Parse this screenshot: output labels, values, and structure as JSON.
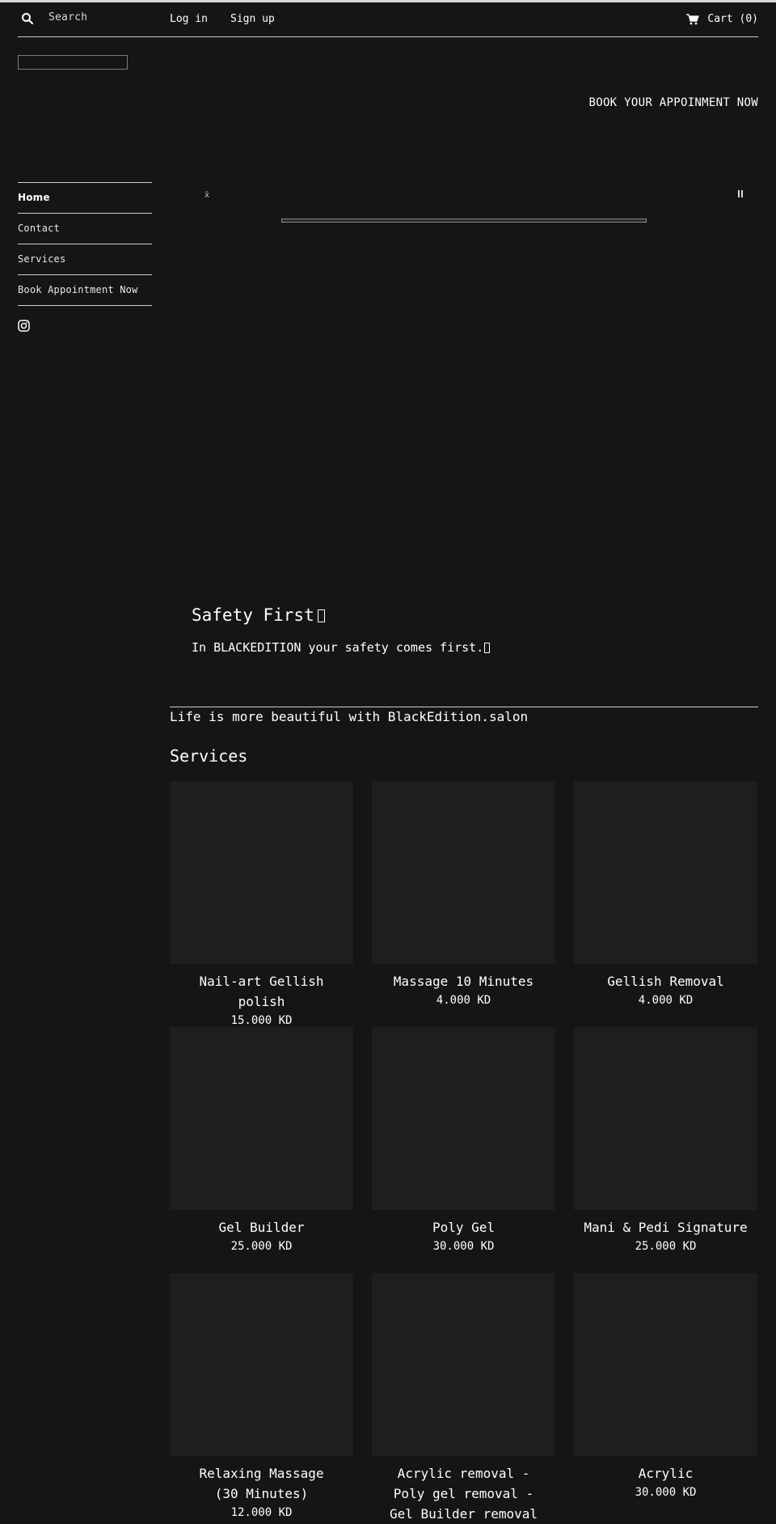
{
  "header": {
    "search_placeholder": "Search",
    "login_label": "Log in",
    "signup_label": "Sign up",
    "cart_label": "Cart (0)"
  },
  "banner": {
    "book_label": "BOOK YOUR APPOINMENT NOW"
  },
  "sidebar": {
    "items": [
      {
        "label": "Home",
        "active": true
      },
      {
        "label": "Contact"
      },
      {
        "label": "Services"
      },
      {
        "label": "Book Appointment Now"
      }
    ],
    "social": [
      "instagram-icon"
    ]
  },
  "slideshow": {
    "prev_glyph": "x̆",
    "pause_icon": "pause-icon",
    "progress": 1.0
  },
  "hero": {
    "title": "Safety First",
    "subtitle": "In BLACKEDITION your safety comes first."
  },
  "tagline": "Life is more beautiful with BlackEdition.salon",
  "services": {
    "heading": "Services",
    "products": [
      {
        "name": "Nail-art Gellish polish",
        "price": "15.000 KD"
      },
      {
        "name": "Massage 10 Minutes",
        "price": "4.000 KD"
      },
      {
        "name": "Gellish Removal",
        "price": "4.000 KD"
      },
      {
        "name": "Gel Builder",
        "price": "25.000 KD"
      },
      {
        "name": "Poly Gel",
        "price": "30.000 KD"
      },
      {
        "name": "Mani & Pedi Signature",
        "price": "25.000 KD"
      },
      {
        "name": "Relaxing Massage (30 Minutes)",
        "price": "12.000 KD"
      },
      {
        "name": "Acrylic removal - Poly gel removal - Gel Builder removal",
        "price": ""
      },
      {
        "name": "Acrylic",
        "price": "30.000 KD"
      }
    ]
  },
  "colors": {
    "background": "#161415",
    "card_image": "#1f1e1f",
    "text": "#ffffff",
    "rule": "#cfcfcf"
  }
}
